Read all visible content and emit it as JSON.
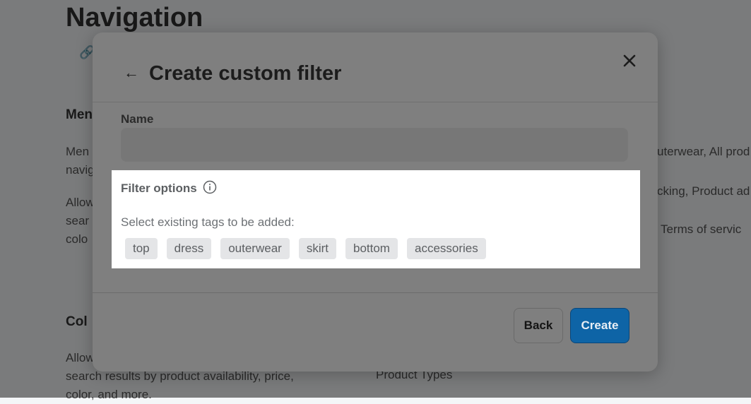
{
  "background": {
    "title": "Navigation",
    "section1_heading": "Men",
    "section1_text_line1": "Men",
    "section1_text_line2": "navig",
    "section1_right_text": "uterwear, All prod",
    "section2_text_line1": "Allow",
    "section2_text_line2": "sear",
    "section2_text_line3": "colo",
    "section2_right_text": "cking, Product ad",
    "section2_right_text2": "Terms of servic",
    "section3_heading": "Col",
    "section3_text_line1": "Allow",
    "section3_text_line2": "search results by product availability, price,",
    "section3_text_line3": "color, and more.",
    "section3_right_text": "Product Types"
  },
  "modal": {
    "title": "Create custom filter",
    "name_label": "Name",
    "name_value": "",
    "filter_options_label": "Filter options",
    "select_prompt": "Select existing tags to be added:",
    "tags": [
      "top",
      "dress",
      "outerwear",
      "skirt",
      "bottom",
      "accessories"
    ],
    "back_button": "Back",
    "create_button": "Create"
  },
  "icons": {
    "back": "arrow-left-icon",
    "close": "close-icon",
    "info": "info-icon",
    "link": "link-icon"
  },
  "colors": {
    "primary": "#0e64a6",
    "tag_bg": "#e4e5e7",
    "highlight_bg": "#ffffff"
  }
}
